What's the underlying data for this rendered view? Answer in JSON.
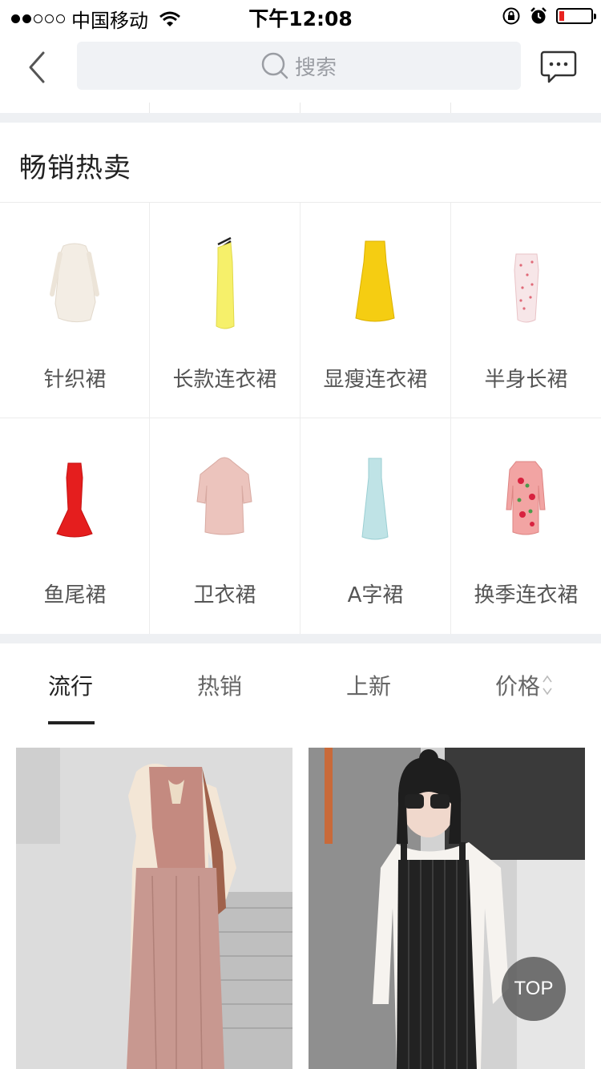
{
  "status_bar": {
    "carrier": "中国移动",
    "time": "下午12:08",
    "signal_bars_filled": 2,
    "signal_bars_total": 5,
    "battery_level": 0.15,
    "battery_color": "#e8221f"
  },
  "nav": {
    "search_placeholder": "搜索"
  },
  "section": {
    "title": "畅销热卖",
    "items": [
      {
        "label": "针织裙",
        "color": "#f3ede4",
        "icon": "knit-dress"
      },
      {
        "label": "长款连衣裙",
        "color": "#f6f06a",
        "icon": "long-dress"
      },
      {
        "label": "显瘦连衣裙",
        "color": "#f5cd12",
        "icon": "slim-dress"
      },
      {
        "label": "半身长裙",
        "color": "#f4d3d6",
        "icon": "long-skirt"
      },
      {
        "label": "鱼尾裙",
        "color": "#e51e1e",
        "icon": "mermaid-dress"
      },
      {
        "label": "卫衣裙",
        "color": "#ecc4bd",
        "icon": "hoodie-dress"
      },
      {
        "label": "A字裙",
        "color": "#bfe3e6",
        "icon": "a-line-dress"
      },
      {
        "label": "换季连衣裙",
        "color": "#f2a4a3",
        "icon": "floral-dress"
      }
    ]
  },
  "tabs": [
    {
      "label": "流行",
      "active": true
    },
    {
      "label": "热销",
      "active": false
    },
    {
      "label": "上新",
      "active": false
    },
    {
      "label": "价格",
      "active": false
    }
  ],
  "top_button": "TOP"
}
